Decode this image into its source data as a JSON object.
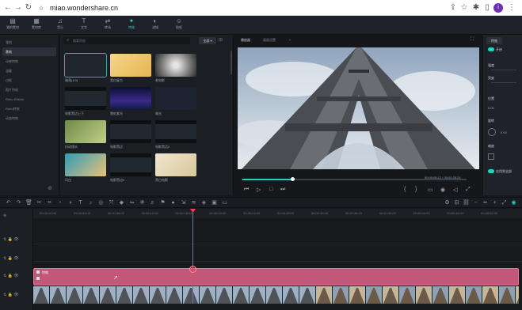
{
  "browser": {
    "url": "miao.wondershare.cn"
  },
  "app_tabs": [
    {
      "label": "我的素材",
      "icon": "folder-icon"
    },
    {
      "label": "素材库",
      "icon": "library-icon"
    },
    {
      "label": "音乐",
      "icon": "music-icon"
    },
    {
      "label": "文字",
      "icon": "text-icon"
    },
    {
      "label": "转场",
      "icon": "transition-icon"
    },
    {
      "label": "特效",
      "icon": "effects-icon"
    },
    {
      "label": "滤镜",
      "icon": "filter-icon"
    },
    {
      "label": "贴纸",
      "icon": "sticker-icon"
    }
  ],
  "active_tab_index": 5,
  "categories": [
    "我的",
    "基础",
    "动感特效",
    "温暖",
    "边框",
    "图片特效",
    "Retro Effects",
    "Retro特效",
    "动态特效"
  ],
  "selected_category_index": 1,
  "search_placeholder": "搜索特效",
  "filter_label": "全部",
  "thumbnails": [
    {
      "label": "暗角(1/3)",
      "style": "dark"
    },
    {
      "label": "黑白复古",
      "style": "yellow"
    },
    {
      "label": "老电影",
      "style": "bw"
    },
    {
      "label": "电影黑边上下",
      "style": "darkbar"
    },
    {
      "label": "霓虹紫光",
      "style": "purple"
    },
    {
      "label": "暗光",
      "style": "darkblue"
    },
    {
      "label": "抖动镜头",
      "style": "green"
    },
    {
      "label": "电影黑边",
      "style": "darkbar"
    },
    {
      "label": "电影黑边2",
      "style": "darkbar"
    },
    {
      "label": "闪白",
      "style": "beach"
    },
    {
      "label": "电影黑边3",
      "style": "darkbar"
    },
    {
      "label": "黑白电影",
      "style": "vintage"
    }
  ],
  "preview": {
    "tabs": [
      "播放器",
      "画面设置"
    ],
    "time_current": "00:00:08:12",
    "time_total": "00:00:28:24",
    "progress": 0.25
  },
  "properties": {
    "title": "特效",
    "toggle_label": "开启",
    "rows": [
      "强度",
      "亮度",
      "位置",
      "旋转",
      "缩放"
    ],
    "value_a": "0.00",
    "value_b": "0.00",
    "apply_label": "应用到全部"
  },
  "timeline": {
    "ticks": [
      "00:00:00:00",
      "00:00:04:00",
      "00:00:08:00",
      "00:00:12:00",
      "00:00:16:00",
      "00:00:20:00",
      "00:00:24:00",
      "00:00:28:00",
      "00:00:32:00",
      "00:00:36:00",
      "00:00:40:00",
      "00:00:44:00",
      "00:00:48:00",
      "00:00:52:00"
    ],
    "effect_clip_label": "特效",
    "playhead_fraction": 0.33
  },
  "colors": {
    "accent": "#22d3c5",
    "clip": "#c2577a",
    "playhead": "#ff3b5c"
  }
}
